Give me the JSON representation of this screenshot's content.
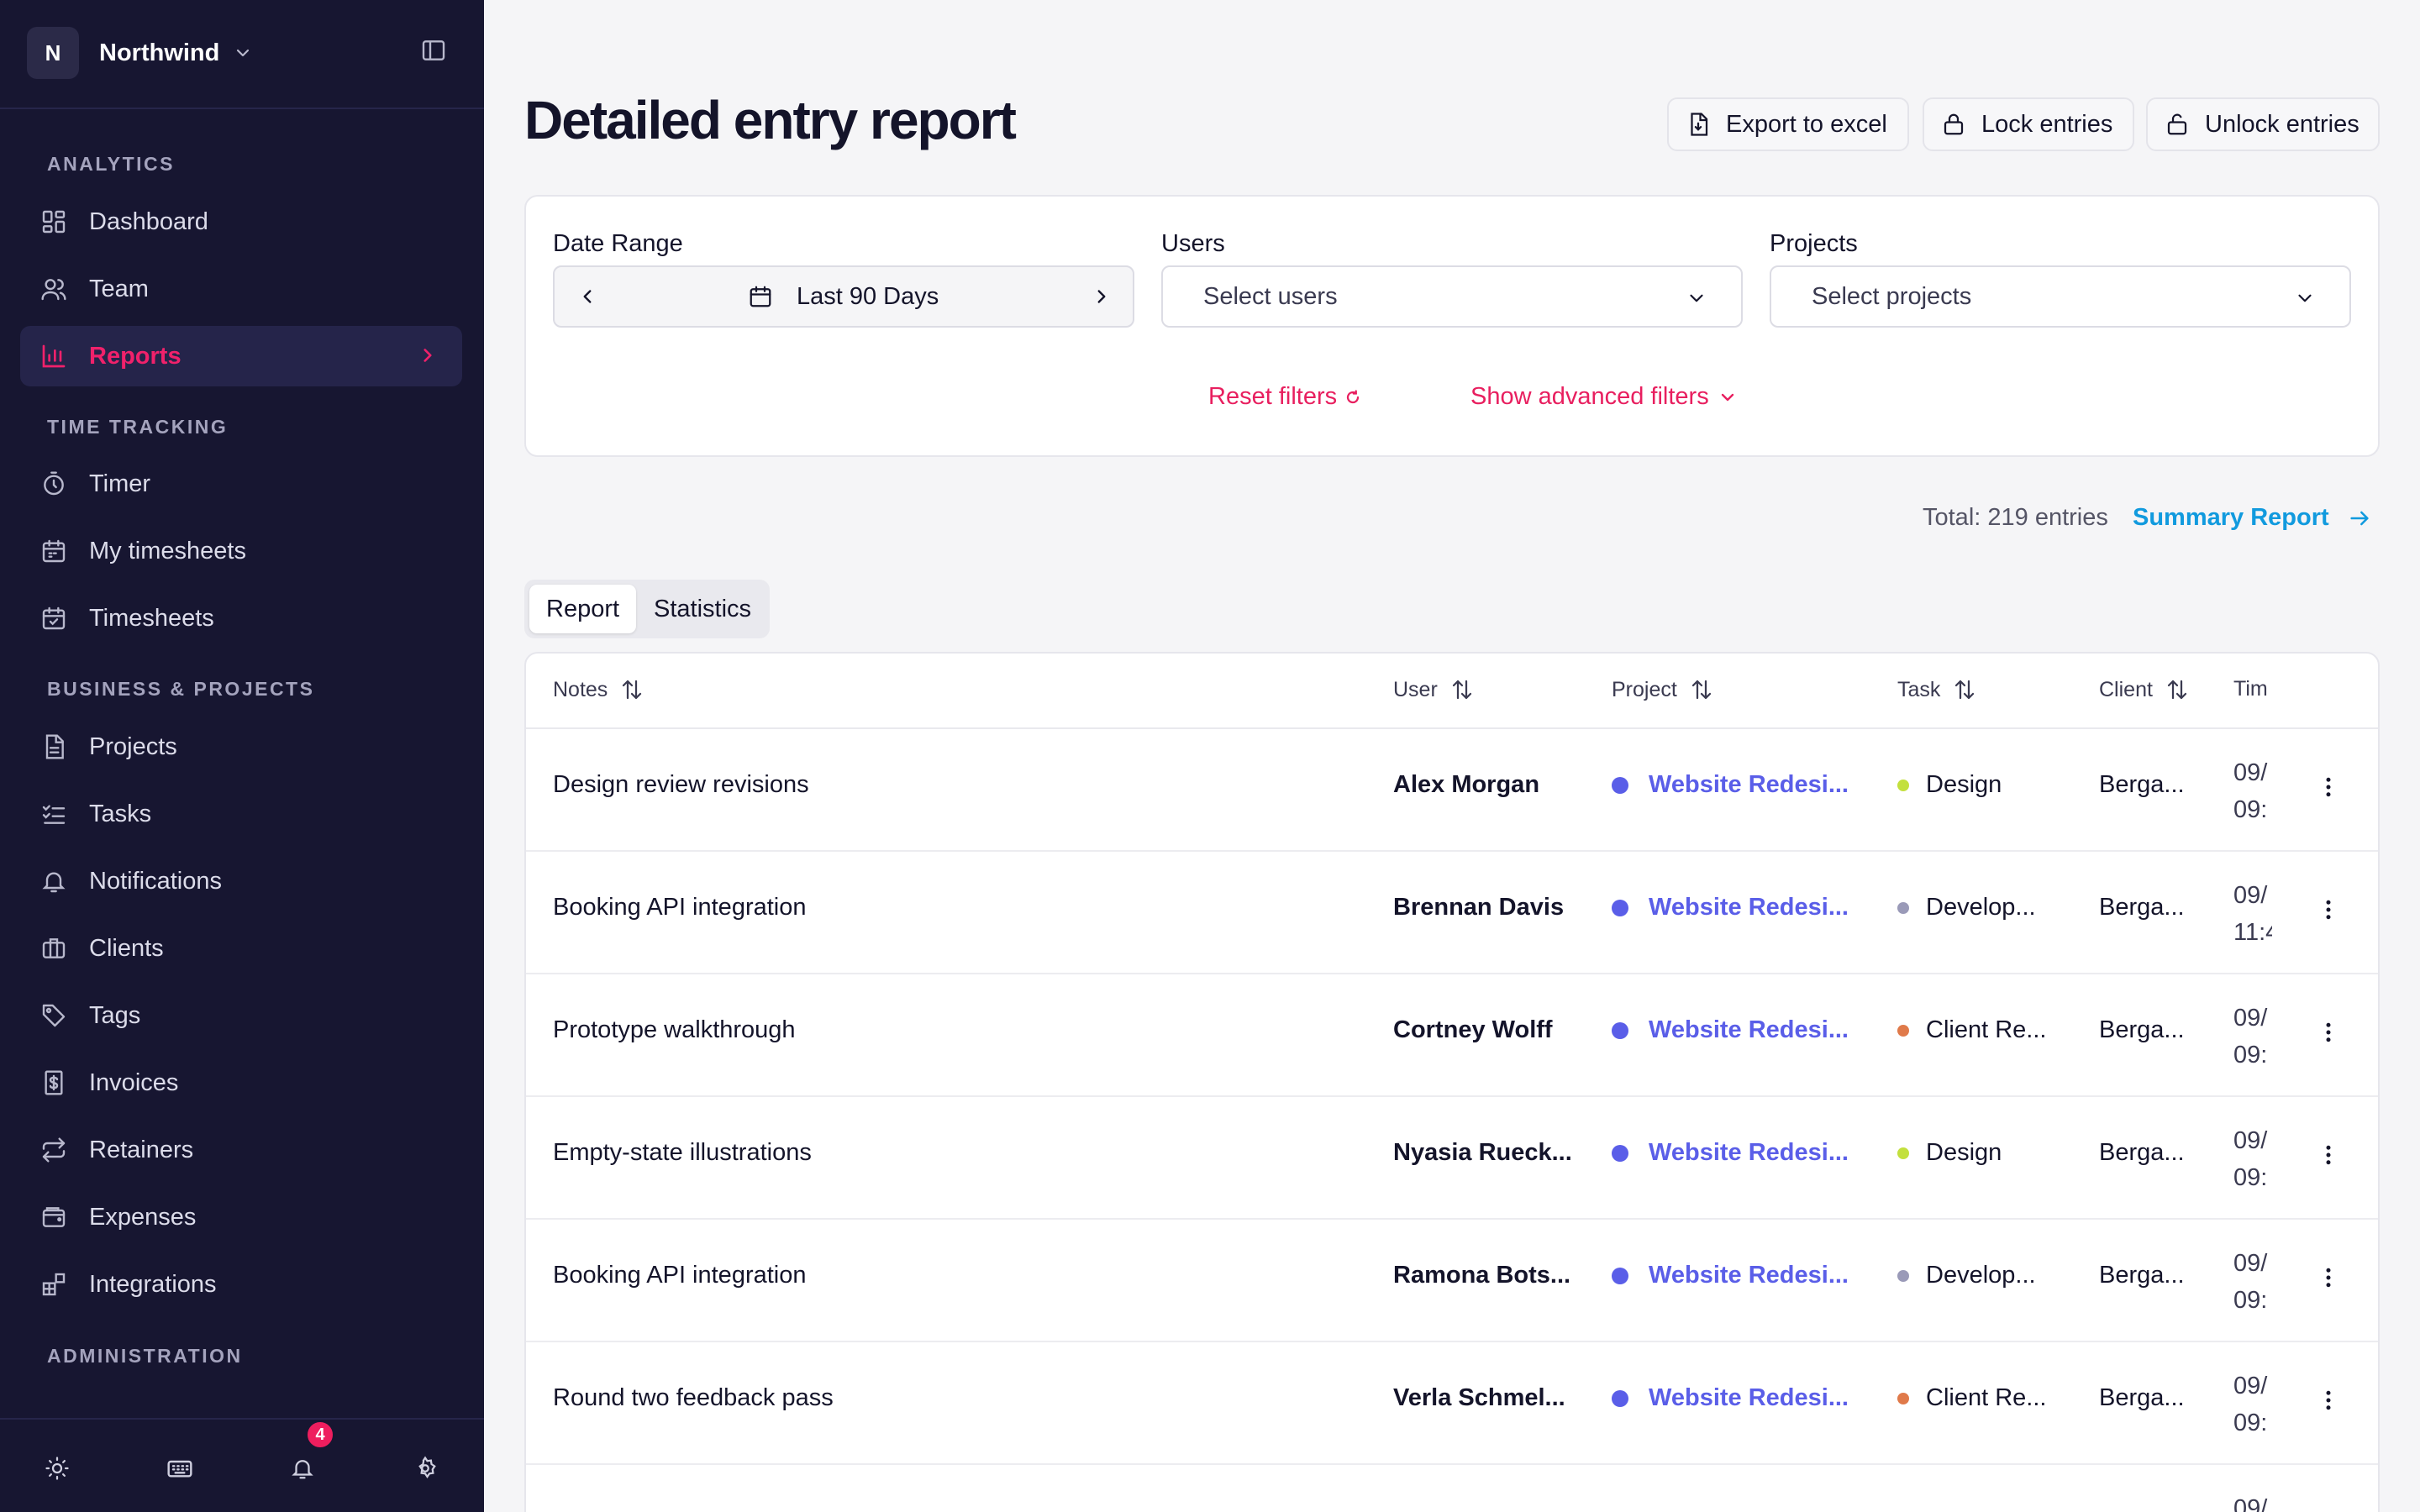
{
  "workspace": {
    "initial": "N",
    "name": "Northwind"
  },
  "sidebar": {
    "sections": {
      "analytics": "ANALYTICS",
      "time_tracking": "TIME TRACKING",
      "business": "BUSINESS & PROJECTS",
      "administration": "ADMINISTRATION"
    },
    "items": {
      "dashboard": "Dashboard",
      "team": "Team",
      "reports": "Reports",
      "timer": "Timer",
      "my_timesheets": "My timesheets",
      "timesheets": "Timesheets",
      "projects": "Projects",
      "tasks": "Tasks",
      "notifications": "Notifications",
      "clients": "Clients",
      "tags": "Tags",
      "invoices": "Invoices",
      "retainers": "Retainers",
      "expenses": "Expenses",
      "integrations": "Integrations"
    },
    "notification_count": "4"
  },
  "header": {
    "title": "Detailed entry report",
    "export_label": "Export to excel",
    "lock_label": "Lock entries",
    "unlock_label": "Unlock entries"
  },
  "filters": {
    "date_range_label": "Date Range",
    "date_range_value": "Last 90 Days",
    "users_label": "Users",
    "users_placeholder": "Select users",
    "projects_label": "Projects",
    "projects_placeholder": "Select projects",
    "reset_label": "Reset filters",
    "advanced_label": "Show advanced filters"
  },
  "summary": {
    "total_text": "Total: 219 entries",
    "summary_link": "Summary Report"
  },
  "tabs": {
    "report": "Report",
    "statistics": "Statistics"
  },
  "table": {
    "columns": {
      "notes": "Notes",
      "user": "User",
      "project": "Project",
      "task": "Task",
      "client": "Client",
      "time": "Tim"
    },
    "rows": [
      {
        "notes": "Design review revisions",
        "user": "Alex Morgan",
        "project": "Website Redesi...",
        "task": "Design",
        "client": "Berga...",
        "time1": "09/",
        "time2": "09:"
      },
      {
        "notes": "Booking API integration",
        "user": "Brennan Davis",
        "project": "Website Redesi...",
        "task": "Develop...",
        "client": "Berga...",
        "time1": "09/",
        "time2": "11:4"
      },
      {
        "notes": "Prototype walkthrough",
        "user": "Cortney Wolff",
        "project": "Website Redesi...",
        "task": "Client Re...",
        "client": "Berga...",
        "time1": "09/",
        "time2": "09:"
      },
      {
        "notes": "Empty-state illustrations",
        "user": "Nyasia Rueck...",
        "project": "Website Redesi...",
        "task": "Design",
        "client": "Berga...",
        "time1": "09/",
        "time2": "09:"
      },
      {
        "notes": "Booking API integration",
        "user": "Ramona Bots...",
        "project": "Website Redesi...",
        "task": "Develop...",
        "client": "Berga...",
        "time1": "09/",
        "time2": "09:"
      },
      {
        "notes": "Round two feedback pass",
        "user": "Verla Schmel...",
        "project": "Website Redesi...",
        "task": "Client Re...",
        "client": "Berga...",
        "time1": "09/",
        "time2": "09:"
      },
      {
        "notes": "",
        "user": "",
        "project": "",
        "task": "",
        "client": "",
        "time1": "09/",
        "time2": ""
      }
    ]
  },
  "colors": {
    "sidebar_bg": "#171631",
    "accent": "#f0216b",
    "link_blue": "#119ade",
    "project_purple": "#5a5ee8",
    "task_design": "#c3e03d",
    "task_develop": "#9a9ab8",
    "task_client": "#e07a4a"
  }
}
